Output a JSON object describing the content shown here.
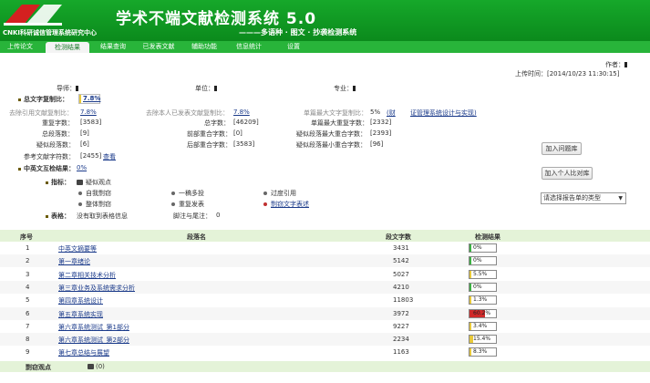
{
  "app": {
    "org_name": "CNKI科研诚信管理系统研究中心",
    "title": "学术不端文献检测系统 5.0",
    "subtitle": "———多语种 · 图文 · 抄袭检测系统"
  },
  "nav": {
    "tabs": [
      "上传论文",
      "检测结果",
      "结果查询",
      "已发表文献",
      "辅助功能",
      "信息统计",
      "设置"
    ],
    "active_index": 1
  },
  "meta": {
    "author_label": "作者：",
    "upload_time_label": "上传时间：",
    "upload_time": "[2014/10/23 11:30:15]"
  },
  "info": {
    "advisor_label": "导师：",
    "unit_label": "单位：",
    "major_label": "专业："
  },
  "summary": {
    "total_ratio_label": "总文字复制比：",
    "total_ratio": "7.8%",
    "excl_ref_label": "去除引用文献复制比：",
    "excl_ref_value": "7.8%",
    "excl_self_label": "去除本人已发表文献复制比：",
    "excl_self_value": "7.8%",
    "single_max_label": "单篇最大文字复制比：",
    "single_max_value": "5%",
    "single_max_link": "(财",
    "single_max_title": "证管理系统设计与实现)",
    "dup_chars_label": "重复字数：",
    "dup_chars": "[3583]",
    "total_chars_label": "总字数：",
    "total_chars": "[46209]",
    "single_max_dup_label": "单篇最大重复字数：",
    "single_max_dup": "[2332]",
    "total_paras_label": "总段落数：",
    "total_paras": "[9]",
    "front_dup_label": "前部重合字数：",
    "front_dup": "[0]",
    "max_para_dup_label": "疑似段落最大重合字数：",
    "max_para_dup": "[2393]",
    "suspect_paras_label": "疑似段落数：",
    "suspect_paras": "[6]",
    "back_dup_label": "后部重合字数：",
    "back_dup": "[3583]",
    "min_para_dup_label": "疑似段落最小重合字数：",
    "min_para_dup": "[96]",
    "ref_chars_label": "参考文献字符数：",
    "ref_chars": "[2455]",
    "view_link": "查看",
    "cn_en_label": "中英文互检结果：",
    "cn_en_value": "0%"
  },
  "indicators": {
    "label": "指标：",
    "suspect_view": "疑似观点",
    "items": [
      "自我剽窃",
      "一稿多投",
      "过度引用",
      "整体剽窃",
      "重复发表",
      "剽窃文字表述"
    ],
    "table_label": "表格：",
    "table_value": "没有取到表格信息",
    "footnote_label": "脚注与尾注：",
    "footnote_value": "0"
  },
  "buttons": {
    "add_ban": "加入问题库",
    "add_personal": "加入个人比对库"
  },
  "select": {
    "value": "请选择报告单的类型"
  },
  "table": {
    "headers": [
      "序号",
      "段落名",
      "段文字数",
      "检测结果"
    ],
    "rows": [
      {
        "no": "1",
        "name": "中英文摘要等",
        "chars": "3431",
        "result": "0%",
        "pct": 0
      },
      {
        "no": "2",
        "name": "第一章绪论",
        "chars": "5142",
        "result": "0%",
        "pct": 0
      },
      {
        "no": "3",
        "name": "第二章相关技术分析",
        "chars": "5027",
        "result": "5.5%",
        "pct": 5.5
      },
      {
        "no": "4",
        "name": "第三章业务及系统需求分析",
        "chars": "4210",
        "result": "0%",
        "pct": 0
      },
      {
        "no": "5",
        "name": "第四章系统设计",
        "chars": "11803",
        "result": "1.3%",
        "pct": 1.3
      },
      {
        "no": "6",
        "name": "第五章系统实现",
        "chars": "3972",
        "result": "60.2%",
        "pct": 60.2
      },
      {
        "no": "7",
        "name": "第六章系统测试_第1部分",
        "chars": "9227",
        "result": "3.4%",
        "pct": 3.4
      },
      {
        "no": "8",
        "name": "第六章系统测试_第2部分",
        "chars": "2234",
        "result": "15.4%",
        "pct": 15.4
      },
      {
        "no": "9",
        "name": "第七章总结与展望",
        "chars": "1163",
        "result": "8.3%",
        "pct": 8.3
      }
    ]
  },
  "footer": {
    "label": "剽窃观点",
    "count": "(0)"
  },
  "colors": {
    "header_green": "#11a024",
    "low_fill": "#e8c93a",
    "high_fill": "#d02a2a",
    "zero_fill": "#3cb043"
  }
}
